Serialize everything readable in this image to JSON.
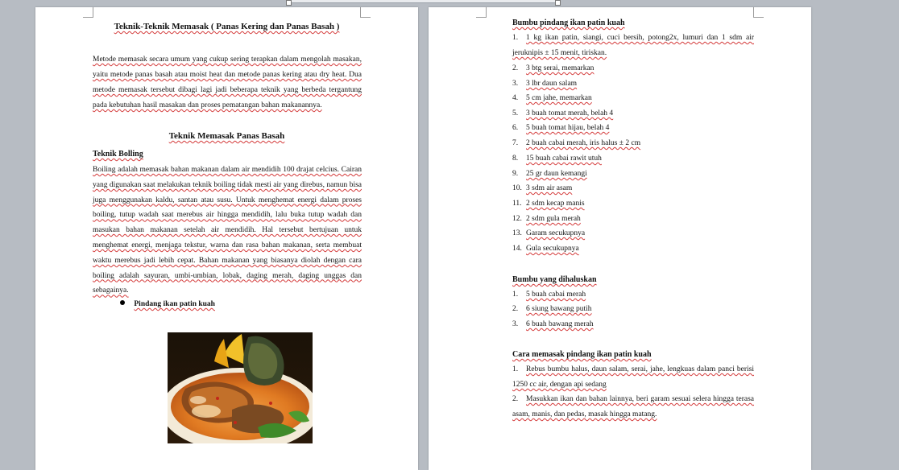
{
  "page1": {
    "title": "Teknik-Teknik Memasak ( Panas Kering dan Panas Basah )",
    "intro": "Metode memasak secara umum yang cukup sering terapkan dalam mengolah masakan, yaitu metode panas basah atau moist heat dan metode panas kering atau dry heat. Dua metode memasak tersebut dibagi lagi jadi beberapa teknik yang berbeda tergantung pada kebutuhan hasil masakan dan proses pematangan bahan makanannya.",
    "section_title": "Teknik Memasak Panas Basah",
    "subheading": "Teknik Bolling",
    "body": "Boiling adalah memasak bahan makanan dalam air mendidih 100 drajat celcius. Cairan yang digunakan saat melakukan teknik boiling tidak mesti air yang direbus, namun bisa juga menggunakan kaldu, santan atau susu. Untuk menghemat energi dalam proses boiling, tutup wadah saat merebus air hingga mendidih, lalu buka tutup wadah dan masukan bahan makanan setelah air mendidih. Hal tersebut bertujuan untuk menghemat energi, menjaga tekstur, warna dan rasa bahan makanan, serta membuat waktu merebus jadi lebih cepat. Bahan makanan yang biasanya diolah dengan cara boiling adalah sayuran, umbi-umbian, lobak, daging merah, daging unggas dan sebagainya.",
    "bullet": "Pindang ikan patin kuah"
  },
  "page2": {
    "heading_ingredients": "Bumbu pindang ikan patin kuah",
    "ingredients": [
      {
        "num": "1.",
        "lines": [
          "1 kg ikan patin, siangi, cuci bersih, potong2x, lumuri dan 1 sdm air",
          "jeruknipis ± 15 menit, tiriskan."
        ]
      },
      {
        "num": "2.",
        "lines": [
          "3 btg serai, memarkan"
        ]
      },
      {
        "num": "3.",
        "lines": [
          "3 lbr daun salam"
        ]
      },
      {
        "num": "4.",
        "lines": [
          "5 cm jahe, memarkan"
        ]
      },
      {
        "num": "5.",
        "lines": [
          "3 buah tomat merah, belah 4"
        ]
      },
      {
        "num": "6.",
        "lines": [
          "5 buah tomat hijau, belah 4"
        ]
      },
      {
        "num": "7.",
        "lines": [
          "2 buah cabai merah, iris halus ± 2 cm"
        ]
      },
      {
        "num": "8.",
        "lines": [
          "15 buah cabai rawit utuh"
        ]
      },
      {
        "num": "9.",
        "lines": [
          "25 gr daun kemangi"
        ]
      },
      {
        "num": "10.",
        "lines": [
          "3 sdm air asam"
        ]
      },
      {
        "num": "11.",
        "lines": [
          "2 sdm kecap manis"
        ]
      },
      {
        "num": "12.",
        "lines": [
          "2 sdm gula merah"
        ]
      },
      {
        "num": "13.",
        "lines": [
          "Garam secukupnya"
        ]
      },
      {
        "num": "14.",
        "lines": [
          "Gula secukupnya"
        ]
      }
    ],
    "heading_ground": "Bumbu yang dihaluskan",
    "ground": [
      {
        "num": "1.",
        "text": "5 buah cabai merah"
      },
      {
        "num": "2.",
        "text": "6 siung bawang putih"
      },
      {
        "num": "3.",
        "text": "6 buah bawang merah"
      }
    ],
    "heading_method": "Cara memasak pindang ikan patin kuah",
    "method": [
      {
        "num": "1.",
        "lines": [
          "Rebus bumbu halus, daun salam, serai, jahe, lengkuas dalam panci berisi",
          "1250 cc air, dengan api sedang"
        ]
      },
      {
        "num": "2.",
        "lines": [
          "Masukkan ikan dan bahan lainnya, beri garam sesuai selera hingga terasa",
          "asam, manis, dan pedas, masak hingga matang."
        ]
      }
    ]
  }
}
